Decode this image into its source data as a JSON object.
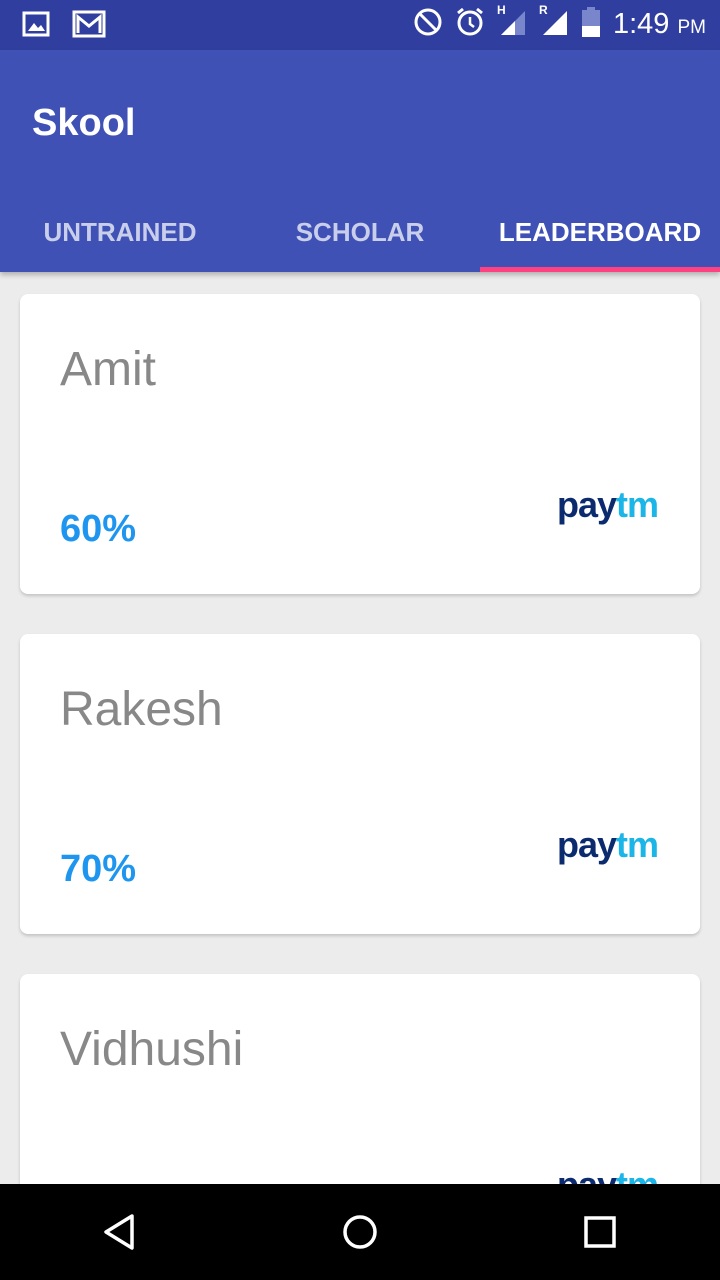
{
  "status_bar": {
    "time": "1:49",
    "ampm": "PM",
    "net_h": "H",
    "net_r": "R",
    "icons": [
      "image-icon",
      "gmail-icon",
      "do-not-disturb-icon",
      "alarm-icon",
      "signal-h-icon",
      "signal-r-icon",
      "battery-icon"
    ]
  },
  "app": {
    "title": "Skool"
  },
  "tabs": [
    {
      "label": "UNTRAINED"
    },
    {
      "label": "SCHOLAR"
    },
    {
      "label": "LEADERBOARD"
    }
  ],
  "colors": {
    "primary": "#3f51b5",
    "primary_dark": "#303f9f",
    "accent": "#ff4081",
    "percent": "#1e96f0"
  },
  "leaderboard": [
    {
      "name": "Amit",
      "percent": "60%",
      "logo": {
        "pay": "pay",
        "tm": "tm"
      }
    },
    {
      "name": "Rakesh",
      "percent": "70%",
      "logo": {
        "pay": "pay",
        "tm": "tm"
      }
    },
    {
      "name": "Vidhushi",
      "percent": "",
      "logo": {
        "pay": "pay",
        "tm": "tm"
      }
    }
  ],
  "nav_bar": {
    "icons": [
      "back-icon",
      "home-icon",
      "recents-icon"
    ]
  }
}
